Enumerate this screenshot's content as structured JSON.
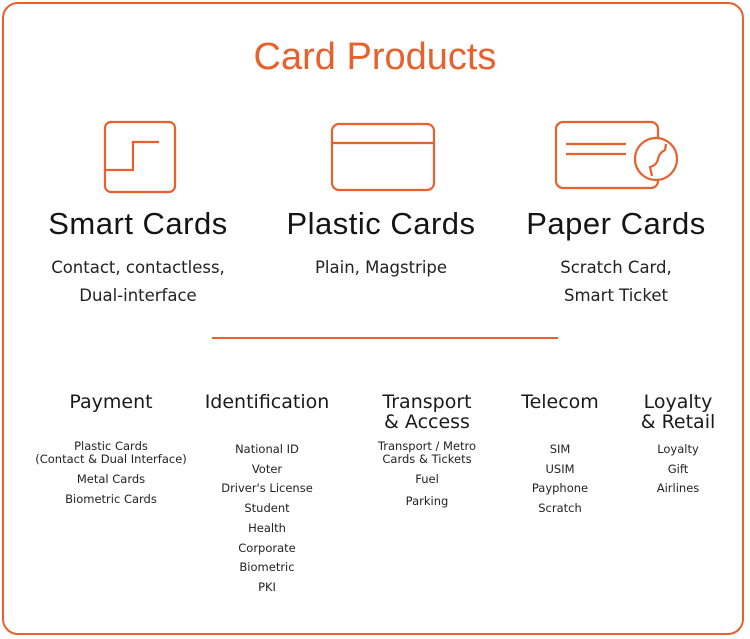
{
  "colors": {
    "accent": "#e8602c",
    "text": "#1c1c1c",
    "background": "#ffffff"
  },
  "title": "Card Products",
  "products": [
    {
      "icon": "smart-card-chip-icon",
      "name": "Smart Cards",
      "lines": [
        "Contact, contactless,",
        "Dual-interface"
      ]
    },
    {
      "icon": "plastic-card-icon",
      "name": "Plastic Cards",
      "lines": [
        "Plain, Magstripe"
      ]
    },
    {
      "icon": "paper-card-scratch-icon",
      "name": "Paper Cards",
      "lines": [
        "Scratch Card,",
        "Smart Ticket"
      ]
    }
  ],
  "categories": [
    {
      "head": [
        "Payment"
      ],
      "items": [
        "Plastic Cards",
        "(Contact & Dual Interface)",
        "Metal Cards",
        "Biometric Cards"
      ]
    },
    {
      "head": [
        "Identification"
      ],
      "items": [
        "National ID",
        "Voter",
        "Driver's License",
        "Student",
        "Health",
        "Corporate",
        "Biometric",
        "PKI"
      ]
    },
    {
      "head": [
        "Transport",
        "& Access"
      ],
      "items": [
        "Transport / Metro",
        "Cards & Tickets",
        "Fuel",
        "Parking"
      ]
    },
    {
      "head": [
        "Telecom"
      ],
      "items": [
        "SIM",
        "USIM",
        "Payphone",
        "Scratch"
      ]
    },
    {
      "head": [
        "Loyalty",
        "& Retail"
      ],
      "items": [
        "Loyalty",
        "Gift",
        "Airlines"
      ]
    }
  ]
}
